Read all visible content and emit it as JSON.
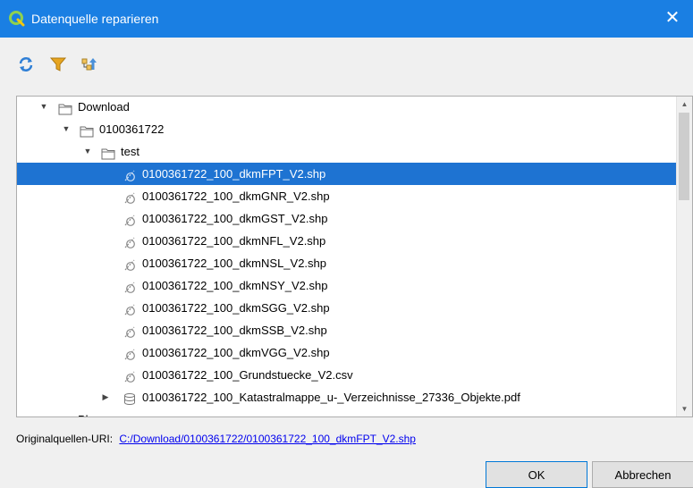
{
  "window": {
    "title": "Datenquelle reparieren",
    "close_glyph": "✕",
    "accent_color": "#1a7fe3"
  },
  "toolbar": {
    "buttons": [
      {
        "icon": "refresh-icon"
      },
      {
        "icon": "filter-icon"
      },
      {
        "icon": "collapse-tree-icon"
      }
    ]
  },
  "tree": {
    "rows": [
      {
        "label": "Download",
        "icon": "folder-icon",
        "level": 1,
        "expander": "expanded"
      },
      {
        "label": "0100361722",
        "icon": "folder-icon",
        "level": 2,
        "expander": "expanded"
      },
      {
        "label": "test",
        "icon": "folder-icon",
        "level": 3,
        "expander": "expanded"
      },
      {
        "label": "0100361722_100_dkmFPT_V2.shp",
        "icon": "vector-layer-icon",
        "level": 4,
        "selected": true
      },
      {
        "label": "0100361722_100_dkmGNR_V2.shp",
        "icon": "vector-layer-icon",
        "level": 4
      },
      {
        "label": "0100361722_100_dkmGST_V2.shp",
        "icon": "vector-layer-icon",
        "level": 4
      },
      {
        "label": "0100361722_100_dkmNFL_V2.shp",
        "icon": "vector-layer-icon",
        "level": 4
      },
      {
        "label": "0100361722_100_dkmNSL_V2.shp",
        "icon": "vector-layer-icon",
        "level": 4
      },
      {
        "label": "0100361722_100_dkmNSY_V2.shp",
        "icon": "vector-layer-icon",
        "level": 4
      },
      {
        "label": "0100361722_100_dkmSGG_V2.shp",
        "icon": "vector-layer-icon",
        "level": 4
      },
      {
        "label": "0100361722_100_dkmSSB_V2.shp",
        "icon": "vector-layer-icon",
        "level": 4
      },
      {
        "label": "0100361722_100_dkmVGG_V2.shp",
        "icon": "vector-layer-icon",
        "level": 4
      },
      {
        "label": "0100361722_100_Grundstuecke_V2.csv",
        "icon": "vector-layer-icon",
        "level": 4
      },
      {
        "label": "0100361722_100_Katastralmappe_u-_Verzeichnisse_27336_Objekte.pdf",
        "icon": "database-icon",
        "level": 4,
        "expander": "collapsed"
      },
      {
        "label": "Pl",
        "icon": "folder-icon",
        "level": 1,
        "expander": "collapsed"
      }
    ],
    "selection_color": "#1e73d2"
  },
  "uri": {
    "label": "Originalquellen-URI:",
    "value": "C:/Download/0100361722/0100361722_100_dkmFPT_V2.shp"
  },
  "buttons": {
    "ok_label": "OK",
    "cancel_label": "Abbrechen"
  }
}
